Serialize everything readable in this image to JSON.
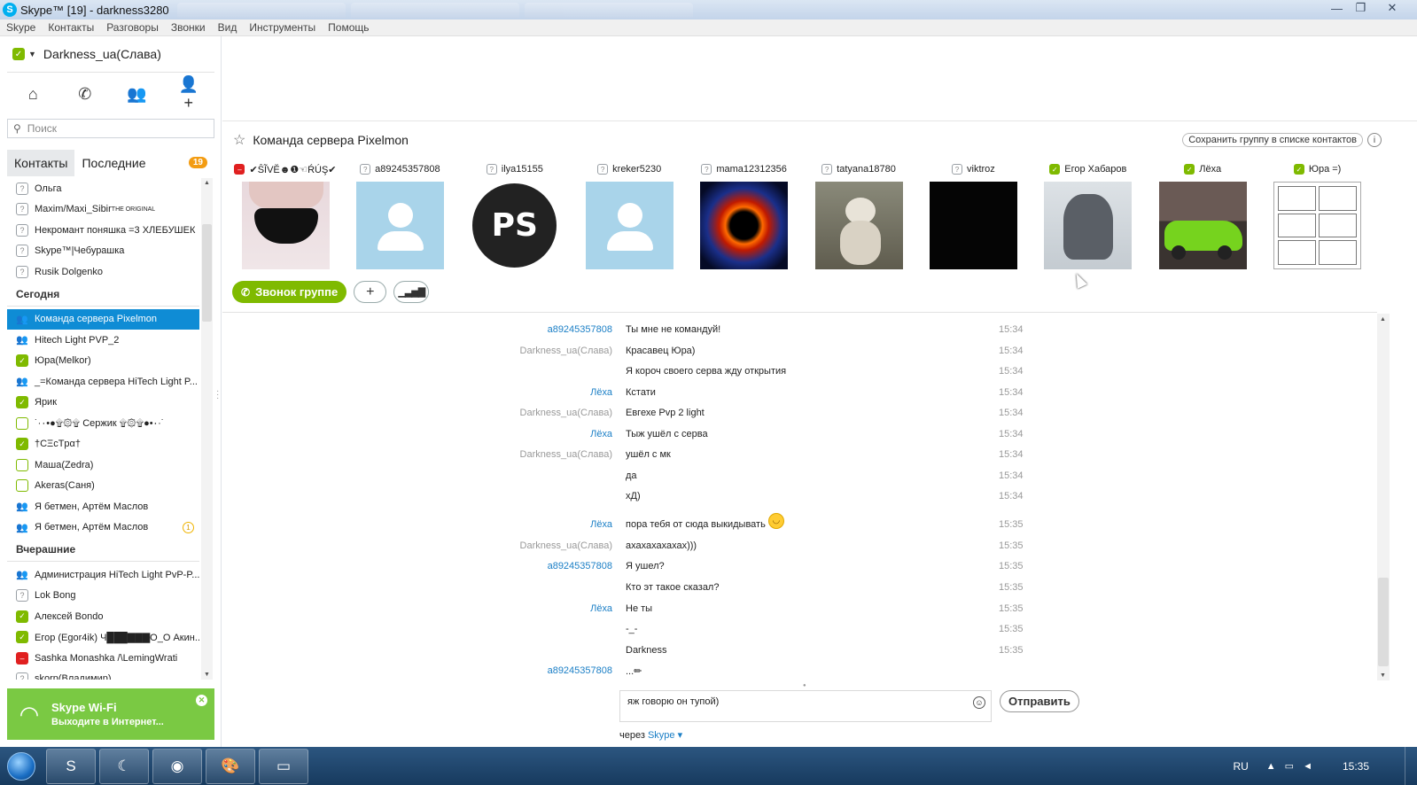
{
  "window": {
    "title": "Skype™ [19] - darkness3280",
    "controls": [
      "—",
      "❐",
      "✕"
    ]
  },
  "menu": [
    "Skype",
    "Контакты",
    "Разговоры",
    "Звонки",
    "Вид",
    "Инструменты",
    "Помощь"
  ],
  "profile": {
    "name": "Darkness_ua(Слава)",
    "status": "online"
  },
  "search": {
    "placeholder": "Поиск"
  },
  "tabs": {
    "contacts": "Контакты",
    "recent": "Последние",
    "recent_badge": "19"
  },
  "contacts": {
    "pre": [
      {
        "name": "Ольга",
        "status": "unknown"
      },
      {
        "name": "Maxim/Maxi_Sibir",
        "suffix": "THE ORIGINAL",
        "status": "unknown"
      },
      {
        "name": "Некромант поняшка =3 ХЛЕБУШЕК",
        "status": "unknown"
      },
      {
        "name": "Skype™|Чебурашка",
        "status": "unknown"
      },
      {
        "name": "Rusik Dolgenko",
        "status": "unknown"
      }
    ],
    "today_header": "Сегодня",
    "today": [
      {
        "name": "Команда сервера Pixelmon",
        "status": "group",
        "selected": true
      },
      {
        "name": "Hitech Light PVP_2",
        "status": "group"
      },
      {
        "name": "Юра(Melkor)",
        "status": "online"
      },
      {
        "name": "_=Команда сервера HiTech Light P...",
        "status": "group"
      },
      {
        "name": "Ярик",
        "status": "online"
      },
      {
        "name": "˙·٠•●۩۞۩ Сержик ۩۞۩●•٠·˙",
        "status": "offline"
      },
      {
        "name": "†CΞcTpα†",
        "status": "online"
      },
      {
        "name": "Маша(Zedra)",
        "status": "offline"
      },
      {
        "name": "Akeras(Саня)",
        "status": "offline"
      },
      {
        "name": "Я бетмен, Артём Маслов",
        "status": "group"
      },
      {
        "name": "Я бетмен, Артём Маслов",
        "status": "group",
        "badge": "1"
      }
    ],
    "yesterday_header": "Вчерашние",
    "yesterday": [
      {
        "name": "Администрация HiTech Light PvP-P...",
        "status": "group"
      },
      {
        "name": "Lok Bong",
        "status": "unknown"
      },
      {
        "name": "Алексей Bondo",
        "status": "online"
      },
      {
        "name": "Егор  (Egor4ik) Ч███▇▇▇O_O Акин...",
        "status": "online"
      },
      {
        "name": "Sashka Monashka /\\LemingWrati",
        "status": "busy"
      },
      {
        "name": "skorp(Владимир)",
        "status": "unknown"
      }
    ]
  },
  "wifi_ad": {
    "title": "Skype Wi-Fi",
    "subtitle": "Выходите в Интернет..."
  },
  "conversation": {
    "title": "Команда сервера Pixelmon",
    "save_label": "Сохранить группу в списке контактов",
    "call_label": "Звонок группе",
    "participants": [
      {
        "name": "✔ŜĨVĔ☻❶☜ŔÚŞ✔",
        "status": "busy",
        "pic": "underwear"
      },
      {
        "name": "a89245357808",
        "status": "unknown",
        "pic": "default"
      },
      {
        "name": "ilya15155",
        "status": "unknown",
        "pic": "playstation"
      },
      {
        "name": "kreker5230",
        "status": "unknown",
        "pic": "default"
      },
      {
        "name": "mama12312356",
        "status": "unknown",
        "pic": "fire-planet"
      },
      {
        "name": "tatyana18780",
        "status": "unknown",
        "pic": "cat"
      },
      {
        "name": "viktroz",
        "status": "unknown",
        "pic": "black"
      },
      {
        "name": "Егор Хабаров",
        "status": "online",
        "pic": "monster"
      },
      {
        "name": "Лёха",
        "status": "online",
        "pic": "green-car"
      },
      {
        "name": "Юра =)",
        "status": "online",
        "pic": "comic"
      }
    ],
    "messages": [
      {
        "sender": "a89245357808",
        "link": true,
        "text": "Ты мне не командуй!",
        "time": "15:34"
      },
      {
        "sender": "Darkness_ua(Слава)",
        "link": false,
        "text": "Красавец Юра)",
        "time": "15:34"
      },
      {
        "sender": "",
        "link": false,
        "text": "Я короч своего серва жду открытия",
        "time": "15:34"
      },
      {
        "sender": "Лёха",
        "link": true,
        "text": "Кстати",
        "time": "15:34"
      },
      {
        "sender": "Darkness_ua(Слава)",
        "link": false,
        "text": "Евгехе Pvp 2 light",
        "time": "15:34"
      },
      {
        "sender": "Лёха",
        "link": true,
        "text": "Тыж ушёл с серва",
        "time": "15:34"
      },
      {
        "sender": "Darkness_ua(Слава)",
        "link": false,
        "text": "ушёл с мк",
        "time": "15:34"
      },
      {
        "sender": "",
        "link": false,
        "text": "да",
        "time": "15:34"
      },
      {
        "sender": "",
        "link": false,
        "text": "хД)",
        "time": "15:34"
      },
      {
        "sender": "Лёха",
        "link": true,
        "text": "пора тебя от сюда выкидывать",
        "time": "15:35",
        "emoji": true
      },
      {
        "sender": "Darkness_ua(Слава)",
        "link": false,
        "text": "ахахахахахах)))",
        "time": "15:35"
      },
      {
        "sender": "a89245357808",
        "link": true,
        "text": "Я ушел?",
        "time": "15:35"
      },
      {
        "sender": "",
        "link": false,
        "text": "Кто эт такое сказал?",
        "time": "15:35"
      },
      {
        "sender": "Лёха",
        "link": true,
        "text": "Не ты",
        "time": "15:35"
      },
      {
        "sender": "",
        "link": false,
        "text": "-_-",
        "time": "15:35"
      },
      {
        "sender": "",
        "link": false,
        "text": "Darkness",
        "time": "15:35"
      },
      {
        "sender": "a89245357808",
        "link": true,
        "text": "...✏",
        "time": ""
      }
    ],
    "input_value": "яж говорю он тупой)",
    "send_label": "Отправить",
    "via_prefix": "через",
    "via_link": "Skype"
  },
  "taskbar": {
    "lang": "RU",
    "time": "15:35"
  },
  "colors": {
    "accent": "#00aff0",
    "online": "#7fba00",
    "selected": "#0f8cd5",
    "link": "#1b7fc6"
  }
}
